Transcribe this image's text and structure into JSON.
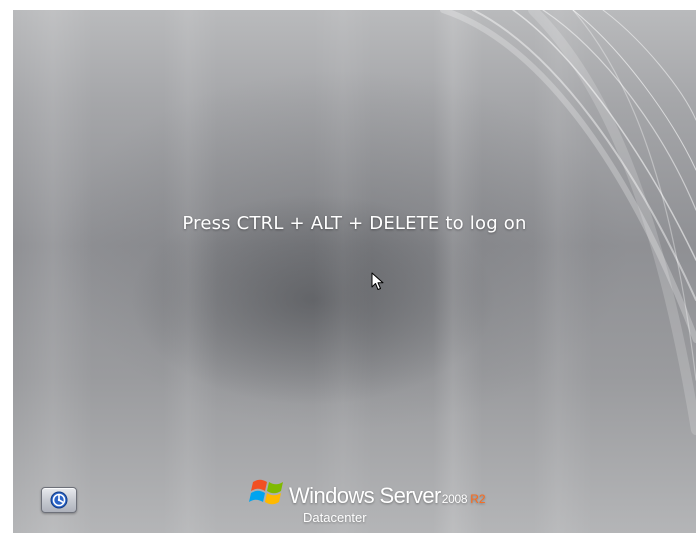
{
  "screen": {
    "message": "Press CTRL + ALT + DELETE to log on"
  },
  "ease_of_access": {
    "icon": "ease-of-access-icon"
  },
  "branding": {
    "logo_icon": "windows-flag-icon",
    "product_name": "Windows Server",
    "version": "2008",
    "release": "R2",
    "edition": "Datacenter",
    "release_color": "#ff6a1a"
  },
  "pointer": {
    "icon": "mouse-pointer-icon"
  }
}
